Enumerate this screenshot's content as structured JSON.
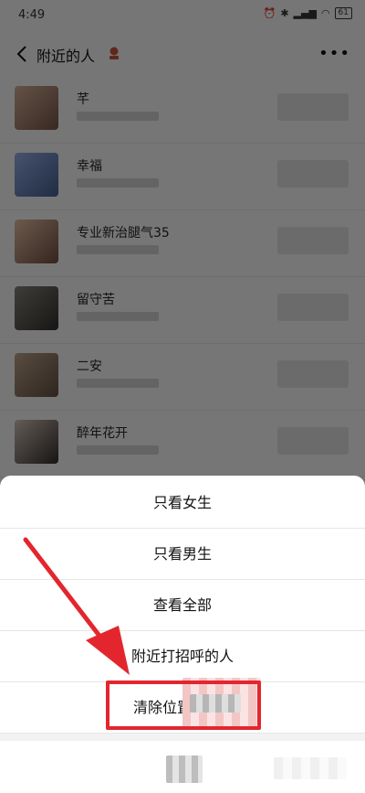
{
  "status_bar": {
    "time": "4:49",
    "battery": "61"
  },
  "nav": {
    "title": "附近的人"
  },
  "list": {
    "items": [
      {
        "name": "芊"
      },
      {
        "name": "幸福"
      },
      {
        "name": "专业新治腿气35"
      },
      {
        "name": "留守苦"
      },
      {
        "name": "二安"
      },
      {
        "name": "醉年花开"
      }
    ]
  },
  "sheet": {
    "items": [
      {
        "label": "只看女生"
      },
      {
        "label": "只看男生"
      },
      {
        "label": "查看全部"
      },
      {
        "label": "附近打招呼的人"
      },
      {
        "label": "清除位置"
      }
    ],
    "cancel": "取"
  },
  "colors": {
    "highlight": "#e3262e",
    "sheet_bg": "#ffffff",
    "page_bg": "#ededed"
  }
}
